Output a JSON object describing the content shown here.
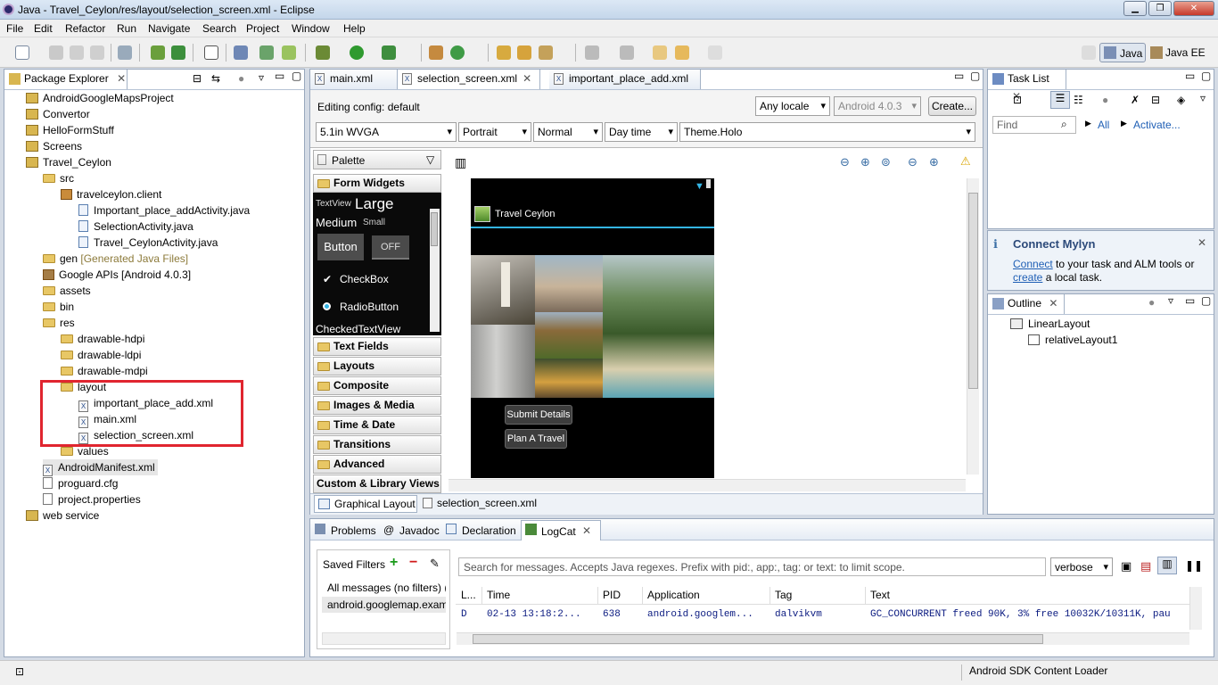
{
  "window": {
    "title": "Java - Travel_Ceylon/res/layout/selection_screen.xml - Eclipse"
  },
  "menu": [
    "File",
    "Edit",
    "Refactor",
    "Run",
    "Navigate",
    "Search",
    "Project",
    "Window",
    "Help"
  ],
  "perspectives": {
    "java": "Java",
    "javaee": "Java EE"
  },
  "package_explorer": {
    "title": "Package Explorer",
    "tree": [
      "AndroidGoogleMapsProject",
      "Convertor",
      "HelloFormStuff",
      "Screens",
      "Travel_Ceylon",
      "src",
      "travelceylon.client",
      "Important_place_addActivity.java",
      "SelectionActivity.java",
      "Travel_CeylonActivity.java",
      "gen",
      "[Generated Java Files]",
      "Google APIs [Android 4.0.3]",
      "assets",
      "bin",
      "res",
      "drawable-hdpi",
      "drawable-ldpi",
      "drawable-mdpi",
      "layout",
      "important_place_add.xml",
      "main.xml",
      "selection_screen.xml",
      "values",
      "AndroidManifest.xml",
      "proguard.cfg",
      "project.properties",
      "web service"
    ]
  },
  "editor": {
    "tabs": [
      "main.xml",
      "selection_screen.xml",
      "important_place_add.xml"
    ],
    "editing_config_label": "Editing config:",
    "editing_config_value": "default",
    "locale": "Any locale",
    "android_version": "Android 4.0.3",
    "create_button": "Create...",
    "device": "5.1in WVGA",
    "orientation": "Portrait",
    "mode": "Normal",
    "time": "Day time",
    "theme": "Theme.Holo",
    "bottom_tabs": [
      "Graphical Layout",
      "selection_screen.xml"
    ]
  },
  "palette": {
    "title": "Palette",
    "form_widgets": "Form Widgets",
    "widgets": {
      "textview": "TextView",
      "large": "Large",
      "medium": "Medium",
      "small": "Small",
      "button": "Button",
      "toggle": "OFF",
      "checkbox": "CheckBox",
      "radio": "RadioButton",
      "checked": "CheckedTextView"
    },
    "sections": [
      "Text Fields",
      "Layouts",
      "Composite",
      "Images & Media",
      "Time & Date",
      "Transitions",
      "Advanced",
      "Custom & Library Views"
    ]
  },
  "phone": {
    "app_title": "Travel Ceylon",
    "buttons": [
      "Submit Details",
      "Plan A Travel"
    ]
  },
  "task_list": {
    "title": "Task List",
    "find_placeholder": "Find",
    "all": "All",
    "activate": "Activate..."
  },
  "mylyn": {
    "title": "Connect Mylyn",
    "connect_link": "Connect",
    "text1": "to your task and ALM tools or",
    "create_link": "create",
    "text2": "a local task."
  },
  "outline": {
    "title": "Outline",
    "items": [
      "LinearLayout",
      "relativeLayout1"
    ]
  },
  "bottom_panel": {
    "tabs": [
      "Problems",
      "Javadoc",
      "Declaration",
      "LogCat"
    ],
    "saved_filters": "Saved Filters",
    "filters": [
      "All messages (no filters) (",
      "android.googlemap.exam"
    ],
    "search_placeholder": "Search for messages. Accepts Java regexes. Prefix with pid:, app:, tag: or text: to limit scope.",
    "level": "verbose",
    "columns": [
      "L...",
      "Time",
      "PID",
      "Application",
      "Tag",
      "Text"
    ],
    "row": [
      "D",
      "02-13 13:18:2...",
      "638",
      "android.googlem...",
      "dalvikvm",
      "GC_CONCURRENT freed 90K, 3% free 10032K/10311K, pau"
    ]
  },
  "status": {
    "text": "Android SDK Content Loader"
  },
  "colors": {
    "highlight_box": "#e0252f",
    "link": "#1f5fb5",
    "phone_bg": "#000000"
  }
}
